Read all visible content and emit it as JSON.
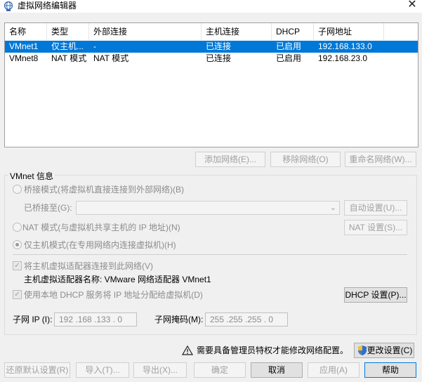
{
  "window": {
    "title": "虚拟网络编辑器",
    "close_glyph": "✕"
  },
  "table": {
    "headers": [
      "名称",
      "类型",
      "外部连接",
      "主机连接",
      "DHCP",
      "子网地址"
    ],
    "rows": [
      {
        "name": "VMnet1",
        "type": "仅主机...",
        "external": "-",
        "host": "已连接",
        "dhcp": "已启用",
        "subnet": "192.168.133.0",
        "selected": true
      },
      {
        "name": "VMnet8",
        "type": "NAT 模式",
        "external": "NAT 模式",
        "host": "已连接",
        "dhcp": "已启用",
        "subnet": "192.168.23.0",
        "selected": false
      }
    ]
  },
  "table_buttons": {
    "add": "添加网络(E)...",
    "remove": "移除网络(O)",
    "rename": "重命名网络(W)..."
  },
  "vmnet_info": {
    "legend": "VMnet 信息",
    "bridged_label": "桥接模式(将虚拟机直接连接到外部网络)(B)",
    "bridged_to_label": "已桥接至(G):",
    "auto_settings": "自动设置(U)...",
    "nat_label": "NAT 模式(与虚拟机共享主机的 IP 地址)(N)",
    "nat_settings": "NAT 设置(S)...",
    "hostonly_label": "仅主机模式(在专用网络内连接虚拟机)(H)",
    "connect_adapter_label": "将主机虚拟适配器连接到此网络(V)",
    "adapter_name_label": "主机虚拟适配器名称: VMware 网络适配器 VMnet1",
    "dhcp_label": "使用本地 DHCP 服务将 IP 地址分配给虚拟机(D)",
    "dhcp_settings": "DHCP 设置(P)...",
    "subnet_ip_label": "子网 IP (I):",
    "subnet_ip_value": "192 .168 .133 . 0",
    "subnet_mask_label": "子网掩码(M):",
    "subnet_mask_value": "255 .255 .255 . 0",
    "mode_selected": "hostonly"
  },
  "admin": {
    "notice": "需要具备管理员特权才能修改网络配置。",
    "change_settings": "更改设置(C)"
  },
  "footer": {
    "restore": "还原默认设置(R)",
    "import": "导入(T)...",
    "export": "导出(X)...",
    "ok": "确定",
    "cancel": "取消",
    "apply": "应用(A)",
    "help": "帮助"
  },
  "colors": {
    "selection": "#0078d7",
    "disabled_text": "#a0a0a0"
  }
}
